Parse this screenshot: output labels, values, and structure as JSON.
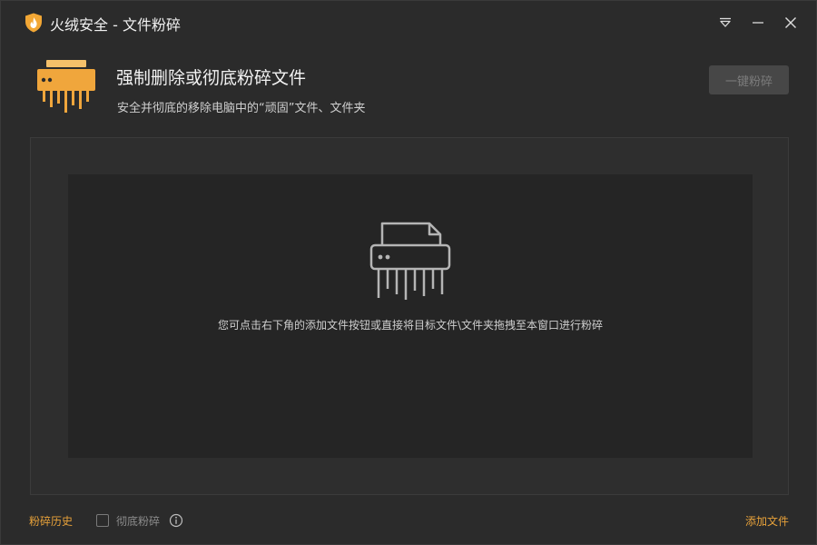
{
  "window": {
    "title": "火绒安全 - 文件粉碎",
    "controls": {
      "menu_icon": "dropdown-menu-icon",
      "minimize_icon": "minimize-icon",
      "close_icon": "close-icon"
    }
  },
  "header": {
    "icon": "shredder-icon",
    "title": "强制删除或彻底粉碎文件",
    "subtitle": "安全并彻底的移除电脑中的“顽固”文件、文件夹",
    "shred_button_label": "一键粉碎"
  },
  "drop_area": {
    "icon": "file-shredder-icon",
    "hint": "您可点击右下角的添加文件按钮或直接将目标文件\\文件夹拖拽至本窗口进行粉碎"
  },
  "footer": {
    "history_label": "粉碎历史",
    "thorough_label": "彻底粉碎",
    "thorough_checked": false,
    "info_icon": "info-icon",
    "add_file_label": "添加文件"
  },
  "colors": {
    "background": "#2b2b2b",
    "accent": "#e8a23a",
    "drop_inner": "#252525",
    "button_disabled": "#474747"
  }
}
